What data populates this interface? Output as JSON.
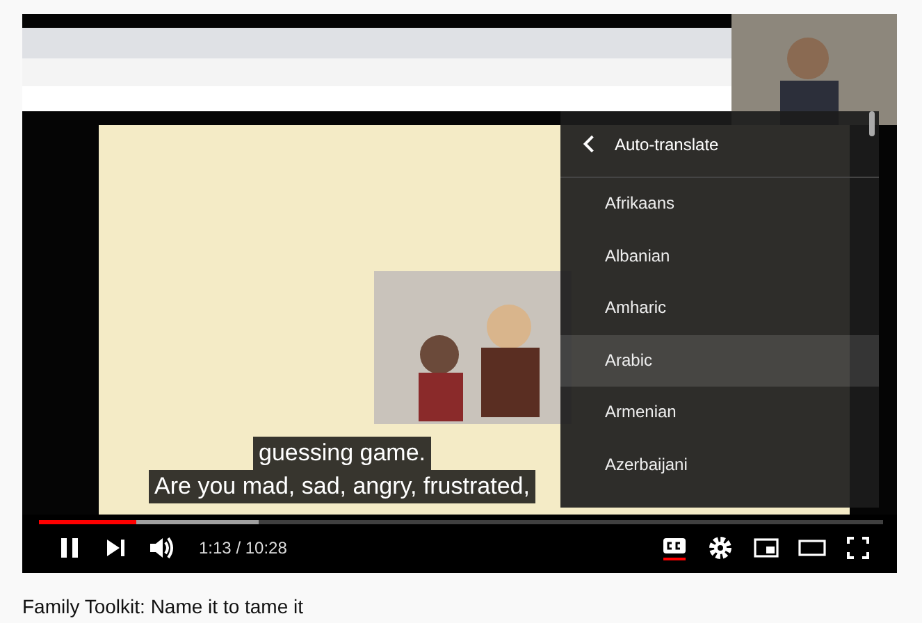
{
  "captions": [
    "guessing game.",
    "Are you mad, sad, angry, frustrated,"
  ],
  "menu": {
    "title": "Auto-translate",
    "items": [
      {
        "label": "Afrikaans",
        "selected": false
      },
      {
        "label": "Albanian",
        "selected": false
      },
      {
        "label": "Amharic",
        "selected": false
      },
      {
        "label": "Arabic",
        "selected": true
      },
      {
        "label": "Armenian",
        "selected": false
      },
      {
        "label": "Azerbaijani",
        "selected": false
      }
    ]
  },
  "controls": {
    "progress": {
      "level": 0.115
    },
    "time": "1:13 / 10:28",
    "captions_on": true
  },
  "title": "Family Toolkit: Name it to tame it"
}
